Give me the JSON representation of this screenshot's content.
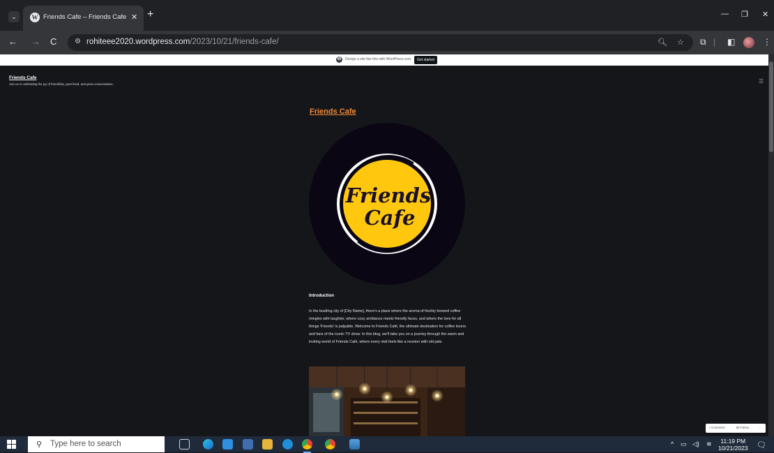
{
  "browser": {
    "tab_title": "Friends Cafe – Friends Cafe",
    "url_host": "rohiteee2020.wordpress.com",
    "url_path": "/2023/10/21/friends-cafe/"
  },
  "wp_bar": {
    "text": "Design a site like this with WordPress.com",
    "button": "Get started"
  },
  "site": {
    "title": "Friends Cafe",
    "tagline": "Join us in celebrating the joy of friendship, good food, and great conversations."
  },
  "post": {
    "title": "Friends Cafe",
    "logo_text_line1": "Friends",
    "logo_text_line2": "Cafe",
    "intro_heading": "Introduction",
    "intro_text": "In the bustling city of [City Name], there's a place where the aroma of freshly brewed coffee mingles with laughter, where cozy ambiance meets friendly faces, and where the love for all things 'Friends' is palpable. Welcome to Friends Café, the ultimate destination for coffee lovers and fans of the iconic TV show. In this blog, we'll take you on a journey through the warm and inviting world of Friends Café, where every visit feels like a reunion with old pals."
  },
  "action_bar": {
    "comment": "Comment",
    "follow": "Follow",
    "more": "···"
  },
  "taskbar": {
    "search_placeholder": "Type here to search",
    "time": "11:19 PM",
    "date": "10/21/2023"
  }
}
